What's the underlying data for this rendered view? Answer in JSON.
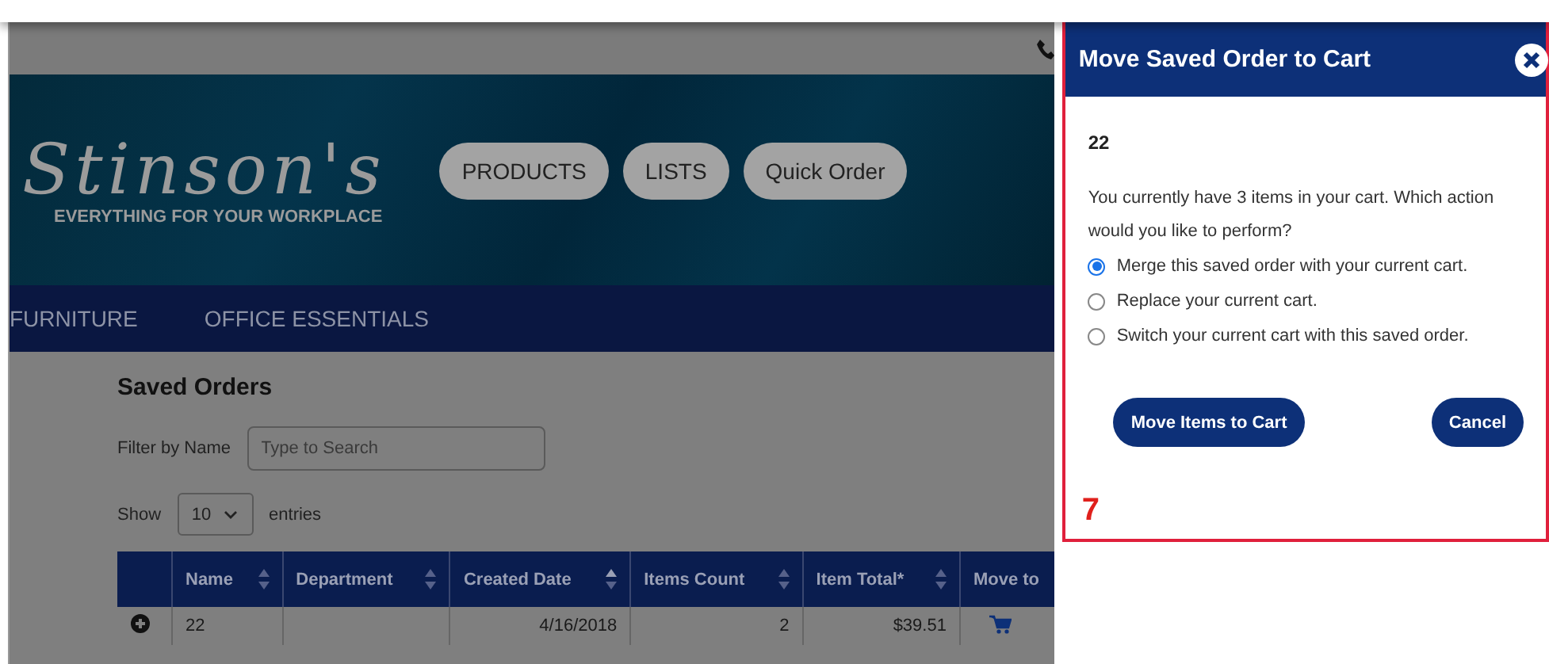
{
  "header": {
    "logo": "Stinson's",
    "tagline": "EVERYTHING FOR YOUR WORKPLACE",
    "nav_buttons": [
      "PRODUCTS",
      "LISTS",
      "Quick Order"
    ]
  },
  "menu": [
    "FURNITURE",
    "OFFICE ESSENTIALS"
  ],
  "saved_orders": {
    "title": "Saved Orders",
    "filter_label": "Filter by Name",
    "search": {
      "placeholder": "Type to Search"
    },
    "show_label": "Show",
    "page_size": "10",
    "entries_label": "entries",
    "columns": [
      {
        "label": "Name",
        "sorted": false
      },
      {
        "label": "Department",
        "sorted": false
      },
      {
        "label": "Created Date",
        "sorted": true
      },
      {
        "label": "Items Count",
        "sorted": false
      },
      {
        "label": "Item Total*",
        "sorted": false
      },
      {
        "label": "Move to"
      }
    ],
    "rows": [
      {
        "name": "22",
        "created_date": "4/16/2018",
        "items_count": "2",
        "item_total": "$39.51"
      }
    ]
  },
  "dialog": {
    "title": "Move Saved Order to Cart",
    "order_name": "22",
    "message": "You currently have 3 items in your cart. Which action would you like to perform?",
    "options": [
      {
        "label": "Merge this saved order with your current cart.",
        "selected": true
      },
      {
        "label": "Replace your current cart.",
        "selected": false
      },
      {
        "label": "Switch your current cart with this saved order.",
        "selected": false
      }
    ],
    "buttons": [
      "Move Items to Cart",
      "Cancel"
    ],
    "annotation": "7"
  }
}
